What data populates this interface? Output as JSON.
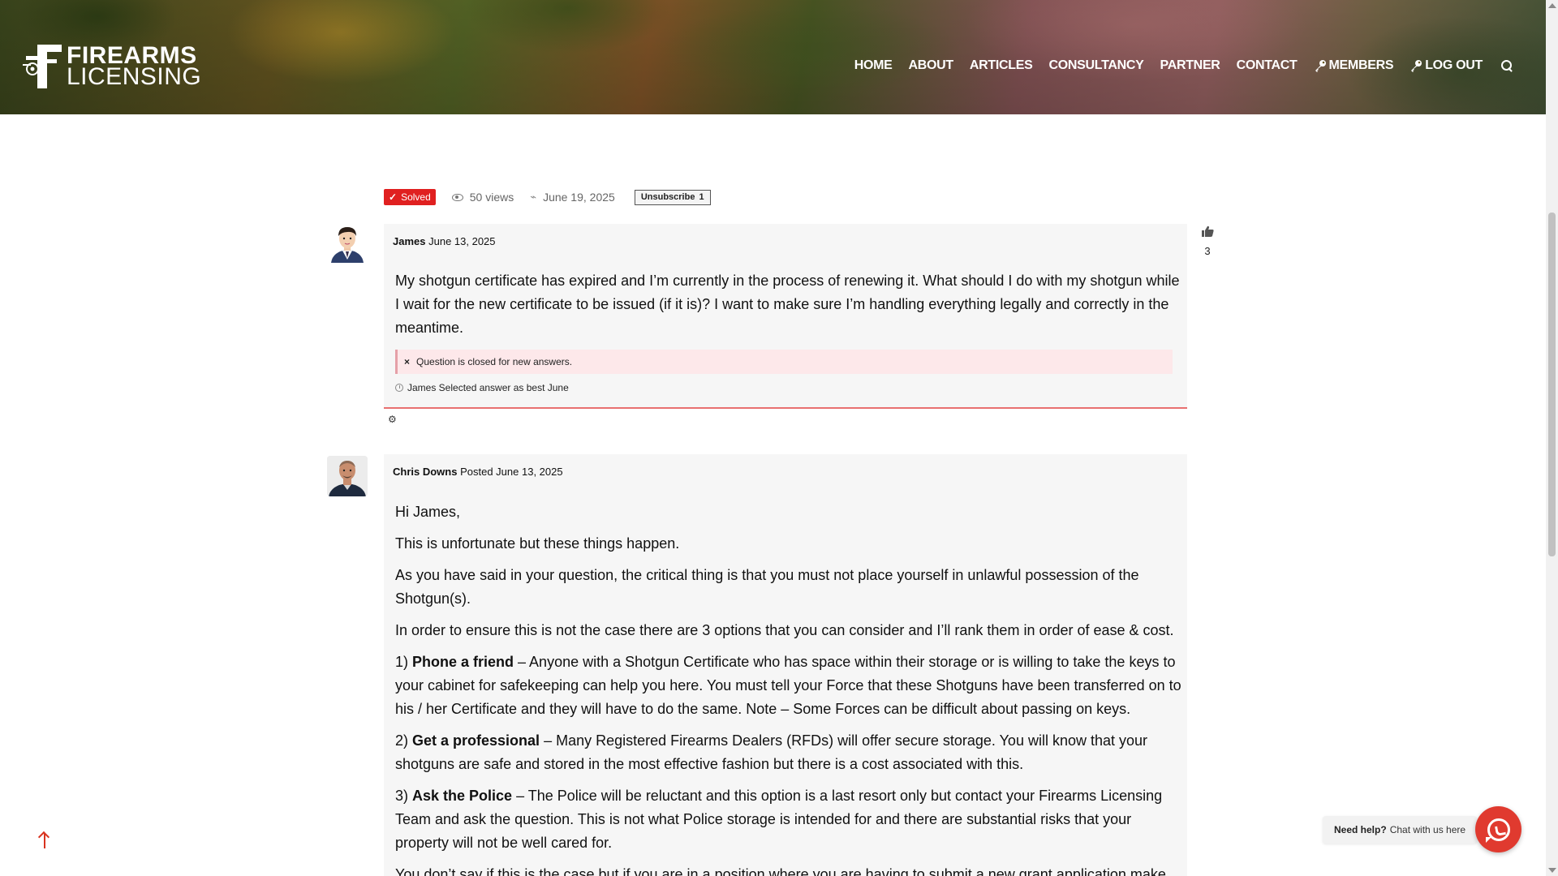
{
  "header": {
    "logo_line1": "FIREARMS",
    "logo_line2": "LICENSING",
    "nav": [
      {
        "label": "HOME"
      },
      {
        "label": "ABOUT"
      },
      {
        "label": "ARTICLES"
      },
      {
        "label": "CONSULTANCY"
      },
      {
        "label": "PARTNER"
      },
      {
        "label": "CONTACT"
      },
      {
        "label": "MEMBERS",
        "icon": "key-icon"
      },
      {
        "label": "LOG OUT",
        "icon": "key-icon"
      }
    ],
    "search_icon": "search-icon"
  },
  "meta": {
    "solved_label": "Solved",
    "views": "50 views",
    "date": "June 19, 2025",
    "unsubscribe_label": "Unsubscribe",
    "unsubscribe_count": "1"
  },
  "question": {
    "author": "James",
    "date": "June 13, 2025",
    "body": "My shotgun certificate has expired and I’m currently in the process of renewing it. What should I do with my shotgun while I wait for the new certificate to be issued (if it is)? I want to make sure I’m handling everything legally and correctly in the meantime.",
    "closed_note": "Question is closed for new answers.",
    "best_note": "James Selected answer as best June",
    "votes": "3"
  },
  "answer": {
    "author": "Chris Downs",
    "posted": "Posted June 13, 2025",
    "p1": "Hi James,",
    "p2": "This is unfortunate but these things happen.",
    "p3": "As you have said in your question, the critical thing is that you must not place yourself in unlawful possession of the Shotgun(s).",
    "p4": "In order to ensure this is not the case there are 3 options that you can consider and I’ll rank them in order of ease & cost.",
    "o1_num": "1) ",
    "o1_title": "Phone a friend",
    "o1_text": " – Anyone with a Shotgun Certificate who has space within their storage or is willing to take the keys to your cabinet for safekeeping can help you here. You must tell your Force that these Shotguns have been transferred on to his / her Certificate and they will have to do the same. Note – Some Forces can be difficult about passing on keys.",
    "o2_num": "2) ",
    "o2_title": "Get a professional",
    "o2_text": " – Many Registered Firearms Dealers (RFDs) will offer secure storage. You will know that your shotguns are safe and stored in the most effective fashion but there is a cost associated with this.",
    "o3_num": "3) ",
    "o3_title": "Ask the Police",
    "o3_text": " – The Police will be reluctant and this option is a last resort only but contact your Firearms Licensing Team and ask the question. This is not what Police storage is intended for and there are substantial risks that your property will not be well cared for.",
    "p5": "You don’t say if this is the case but if you are in a position where you are having to submit a new grant application make"
  },
  "chat": {
    "help_bold": "Need help?",
    "help_text": "Chat with us here"
  },
  "colors": {
    "accent_red": "#e02020",
    "closed_bg": "#fde8ea",
    "card_bg": "#f6f6f6"
  }
}
